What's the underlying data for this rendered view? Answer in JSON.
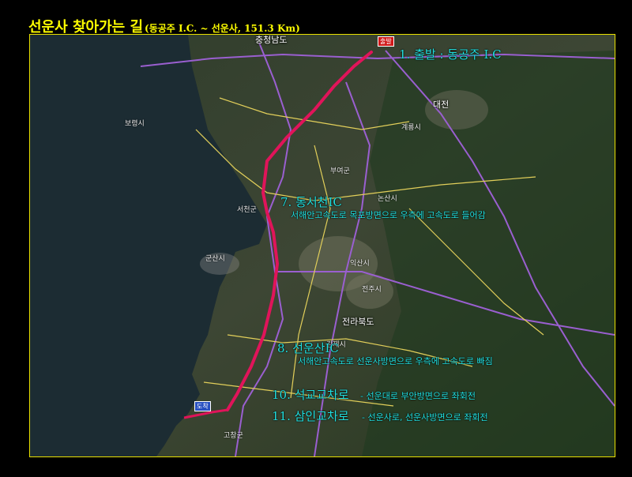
{
  "title": {
    "main": "선운사 찾아가는 길",
    "sub": "(동공주 I.C. ~ 선운사, 151.3 Km)"
  },
  "colors": {
    "title": "#ffff00",
    "annotation": "#21e0e0",
    "route": "#e0145a",
    "frame": "#e8e000"
  },
  "markers": {
    "start": "출발",
    "end": "도착"
  },
  "annotations": {
    "step1": "1. 출발 : 동공주 I.C",
    "step7": "7. 동서천IC",
    "step7_note": "서해안고속도로 목포방면으로 우측에 고속도로 들어감",
    "step8": "8. 선운산IC",
    "step8_note": "서해안고속도로 선운사방면으로 우측에 고속도로 빠짐",
    "step10": "10. 석교교차로",
    "step10_note": "- 선운대로 부안방면으로 좌회전",
    "step11": "11. 삼인교차로",
    "step11_note": "- 선운사로, 선운사방면으로 좌회전"
  },
  "regions": {
    "north": "충청남도",
    "south": "전라북도",
    "daejeon": "대전"
  },
  "place_labels": {
    "gunsan": "군산시",
    "seocheon": "서천군",
    "iksan": "익산시",
    "jeonju": "전주시",
    "gimje": "김제시",
    "buyeo": "부여군",
    "nonsan": "논산시",
    "gyeryong": "계룡시",
    "boryeong": "보령시",
    "gochang": "고창군"
  }
}
